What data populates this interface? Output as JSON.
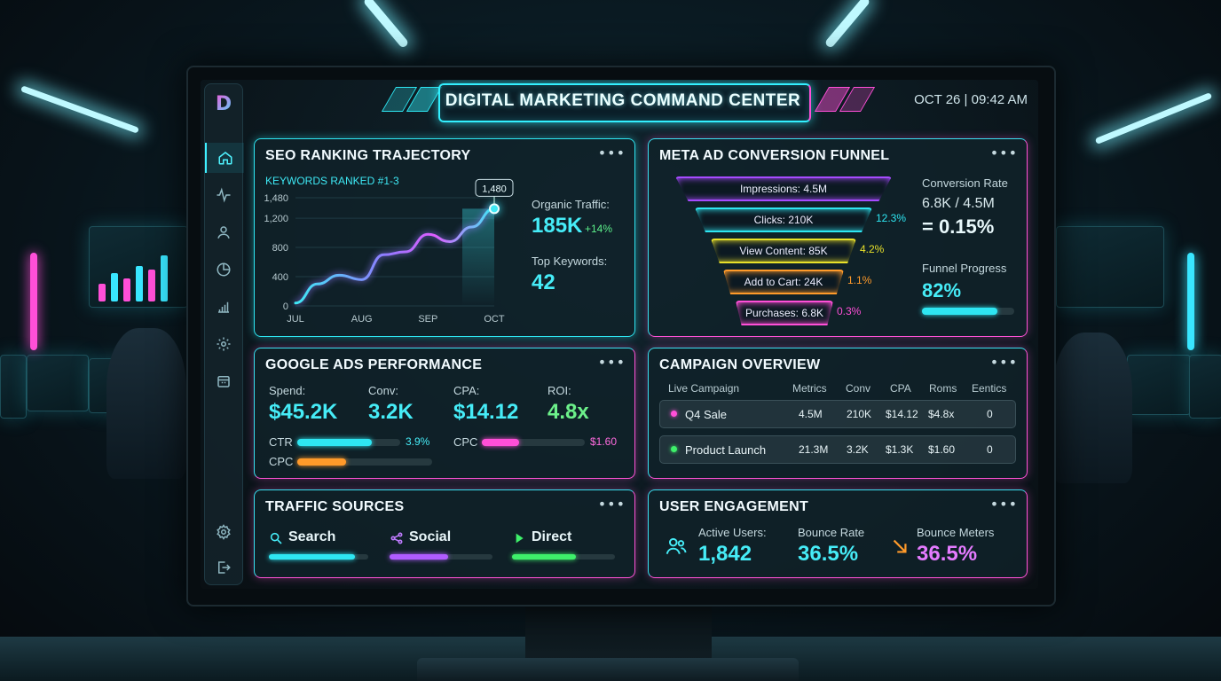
{
  "header": {
    "title": "DIGITAL MARKETING COMMAND CENTER",
    "datetime": "OCT 26 | 09:42 AM"
  },
  "sidebar": {
    "items": [
      {
        "icon": "home-icon",
        "active": true
      },
      {
        "icon": "activity-icon"
      },
      {
        "icon": "user-icon"
      },
      {
        "icon": "pie-chart-icon"
      },
      {
        "icon": "bar-chart-icon"
      },
      {
        "icon": "gear-icon"
      },
      {
        "icon": "calendar-icon"
      },
      {
        "icon": "settings-icon"
      },
      {
        "icon": "logout-icon"
      }
    ]
  },
  "seo": {
    "title": "SEO RANKING TRAJECTORY",
    "subtitle": "KEYWORDS RANKED #1-3",
    "callout": "1,480",
    "organic_label": "Organic Traffic:",
    "organic_value": "185K",
    "organic_change": "+14%",
    "keywords_label": "Top Keywords:",
    "keywords_value": "42",
    "menu": "•••"
  },
  "chart_data": {
    "type": "line",
    "x": [
      "JUL",
      "AUG",
      "SEP",
      "OCT"
    ],
    "xlabels": [
      "JUL",
      "AUG",
      "SEP",
      "OCT"
    ],
    "yticks": [
      "0",
      "400",
      "800",
      "1,200",
      "1,480"
    ],
    "ylim": [
      0,
      1480
    ],
    "series": [
      {
        "x": [
          0,
          0.33,
          0.66,
          1.0,
          1.33,
          1.66,
          2.0,
          2.33,
          2.66,
          3.0
        ],
        "y": [
          40,
          300,
          420,
          360,
          700,
          740,
          980,
          880,
          1080,
          1330
        ]
      }
    ],
    "annotation": "1,480"
  },
  "funnel": {
    "title": "META AD CONVERSION FUNNEL",
    "stages": [
      {
        "label": "Impressions: 4.5M",
        "pct": "",
        "color": "#a64bff"
      },
      {
        "label": "Clicks: 210K",
        "pct": "12.3%",
        "color": "#2ee6f2"
      },
      {
        "label": "View Content: 85K",
        "pct": "4.2%",
        "color": "#e8e02a"
      },
      {
        "label": "Add to Cart: 24K",
        "pct": "1.1%",
        "color": "#ff9a2a"
      },
      {
        "label": "Purchases: 6.8K",
        "pct": "0.3%",
        "color": "#ff4fd8"
      }
    ],
    "conv_label": "Conversion Rate",
    "conv_formula": "6.8K / 4.5M",
    "conv_value": "= 0.15%",
    "progress_label": "Funnel Progress",
    "progress_value": "82%",
    "progress_fraction": 0.82,
    "menu": "•••"
  },
  "gads": {
    "title": "GOOGLE ADS PERFORMANCE",
    "spend_label": "Spend:",
    "spend_value": "$45.2K",
    "conv_label": "Conv:",
    "conv_value": "3.2K",
    "cpa_label": "CPA:",
    "cpa_value": "$14.12",
    "roi_label": "ROI:",
    "roi_value": "4.8x",
    "ctr_label": "CTR",
    "ctr_value": "3.9%",
    "ctr_fraction": 0.72,
    "cpc_label": "CPC",
    "cpc_value": "$1.60",
    "cpc_fraction": 0.36,
    "cpc2_label": "CPC",
    "cpc2_fraction": 0.36,
    "menu": "•••"
  },
  "campaign": {
    "title": "CAMPAIGN OVERVIEW",
    "columns": [
      "Live Campaign",
      "Metrics",
      "Conv",
      "CPA",
      "Roms",
      "Eentics"
    ],
    "rows": [
      {
        "name": "Q4 Sale",
        "dot": "#ff4fd8",
        "cells": [
          "4.5M",
          "210K",
          "$14.12",
          "$4.8x",
          "0"
        ]
      },
      {
        "name": "Product Launch",
        "dot": "#3ef06a",
        "cells": [
          "21.3M",
          "3.2K",
          "$1.3K",
          "$1.60",
          "0"
        ]
      }
    ],
    "menu": "•••"
  },
  "traffic": {
    "title": "TRAFFIC SOURCES",
    "sources": [
      {
        "label": "Search",
        "icon": "search-icon",
        "fraction": 0.87,
        "color": "#2ee6f2"
      },
      {
        "label": "Social",
        "icon": "share-icon",
        "fraction": 0.57,
        "color": "#b05cff"
      },
      {
        "label": "Direct",
        "icon": "play-icon",
        "fraction": 0.62,
        "color": "#3ef06a"
      }
    ],
    "menu": "•••"
  },
  "engagement": {
    "title": "USER ENGAGEMENT",
    "active_label": "Active Users:",
    "active_value": "1,842",
    "bounce_label": "Bounce Rate",
    "bounce_value": "36.5%",
    "meters_label": "Bounce Meters",
    "meters_value": "36.5%",
    "menu": "•••"
  }
}
